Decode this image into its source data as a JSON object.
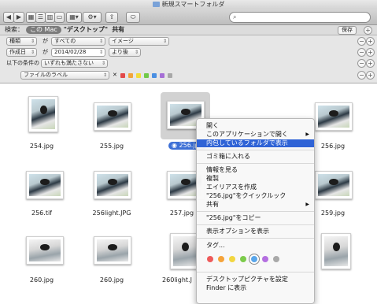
{
  "window": {
    "title": "新規スマートフォルダ"
  },
  "toolbar": {
    "view_buttons": [
      "icon-view",
      "list-view",
      "column-view",
      "coverflow-view"
    ],
    "search_placeholder": ""
  },
  "scope": {
    "label": "検索：",
    "scope_current": "この Mac",
    "scope_desktop": "\"デスクトップ\"",
    "scope_shared": "共有",
    "save_label": "保存"
  },
  "rules": [
    {
      "attr": "種類",
      "op_word": "が",
      "value": "すべての",
      "value2": "イメージ"
    },
    {
      "attr": "作成日",
      "op_word": "が",
      "date": "2014/02/28",
      "value2": "より後"
    },
    {
      "attr": "以下の条件の",
      "value": "いずれも満たさない"
    },
    {
      "attr": "ファイルのラベル",
      "remove": "✕"
    }
  ],
  "label_colors": [
    "#e24a4a",
    "#f2a53a",
    "#f2dc3a",
    "#72c94a",
    "#4a8fe2",
    "#a66fd6",
    "#a8a8a8"
  ],
  "files": [
    {
      "name": "254.jpg"
    },
    {
      "name": "255.jpg"
    },
    {
      "name": "256.jpg"
    },
    {
      "name": ""
    },
    {
      "name": "256.jpg"
    },
    {
      "name": "256.tif"
    },
    {
      "name": "256light.JPG"
    },
    {
      "name": "257.jpg"
    },
    {
      "name": ""
    },
    {
      "name": "259.jpg"
    },
    {
      "name": "260.jpg"
    },
    {
      "name": "260.jpg"
    },
    {
      "name": "260light.J"
    },
    {
      "name": ""
    },
    {
      "name": ""
    }
  ],
  "context_menu": {
    "items": [
      "開く",
      "このアプリケーションで開く",
      "内包しているフォルダで表示",
      "ゴミ箱に入れる",
      "情報を見る",
      "複製",
      "エイリアスを作成",
      "\"256.jpg\"をクイックルック",
      "共有",
      "\"256.jpg\"をコピー",
      "表示オプションを表示",
      "タグ...",
      "デスクトップピクチャを設定",
      "Finder に表示"
    ],
    "tag_colors": [
      "#ee5a5a",
      "#f5a33a",
      "#f2d640",
      "#7ccb4b",
      "#59a6ea",
      "#b46fe0",
      "#a9a9a9"
    ]
  },
  "watermark": "週刊アスキー"
}
